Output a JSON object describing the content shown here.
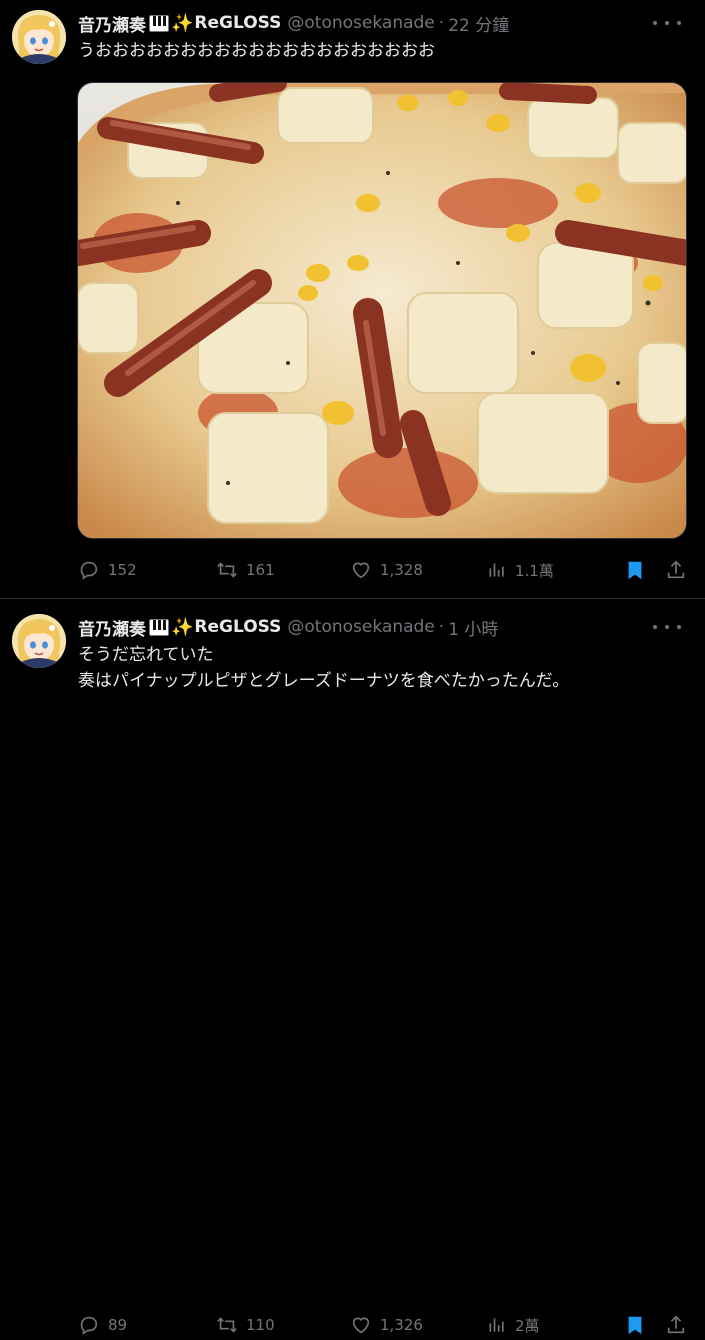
{
  "tweets": [
    {
      "author": {
        "name": "音乃瀬奏",
        "brand": "ReGLOSS",
        "handle": "@otonosekanade"
      },
      "time": "22 分鐘",
      "lines": [
        "うおおおおおおおおおおおおおおおおおおおお"
      ],
      "media": "pizza-photo",
      "stats": {
        "replies": "152",
        "retweets": "161",
        "likes": "1,328",
        "views": "1.1萬"
      }
    },
    {
      "author": {
        "name": "音乃瀬奏",
        "brand": "ReGLOSS",
        "handle": "@otonosekanade"
      },
      "time": "1 小時",
      "lines": [
        "そうだ忘れていた",
        "奏はパイナップルピザとグレーズドーナツを食べたかったんだ。"
      ],
      "stats": {
        "replies": "89",
        "retweets": "110",
        "likes": "1,326",
        "views": "2萬"
      }
    }
  ],
  "dot_separator": "·",
  "icons": {
    "emoji": [
      "piano-keys-icon",
      "sparkles-icon"
    ],
    "actions": [
      "reply-icon",
      "retweet-icon",
      "like-icon",
      "views-icon",
      "bookmark-icon",
      "share-icon"
    ],
    "more": "more-icon"
  },
  "colors": {
    "background": "#000000",
    "text": "#e7e9ea",
    "muted": "#71767b",
    "bookmark": "#1d9bf0",
    "divider": "#2f3336"
  }
}
